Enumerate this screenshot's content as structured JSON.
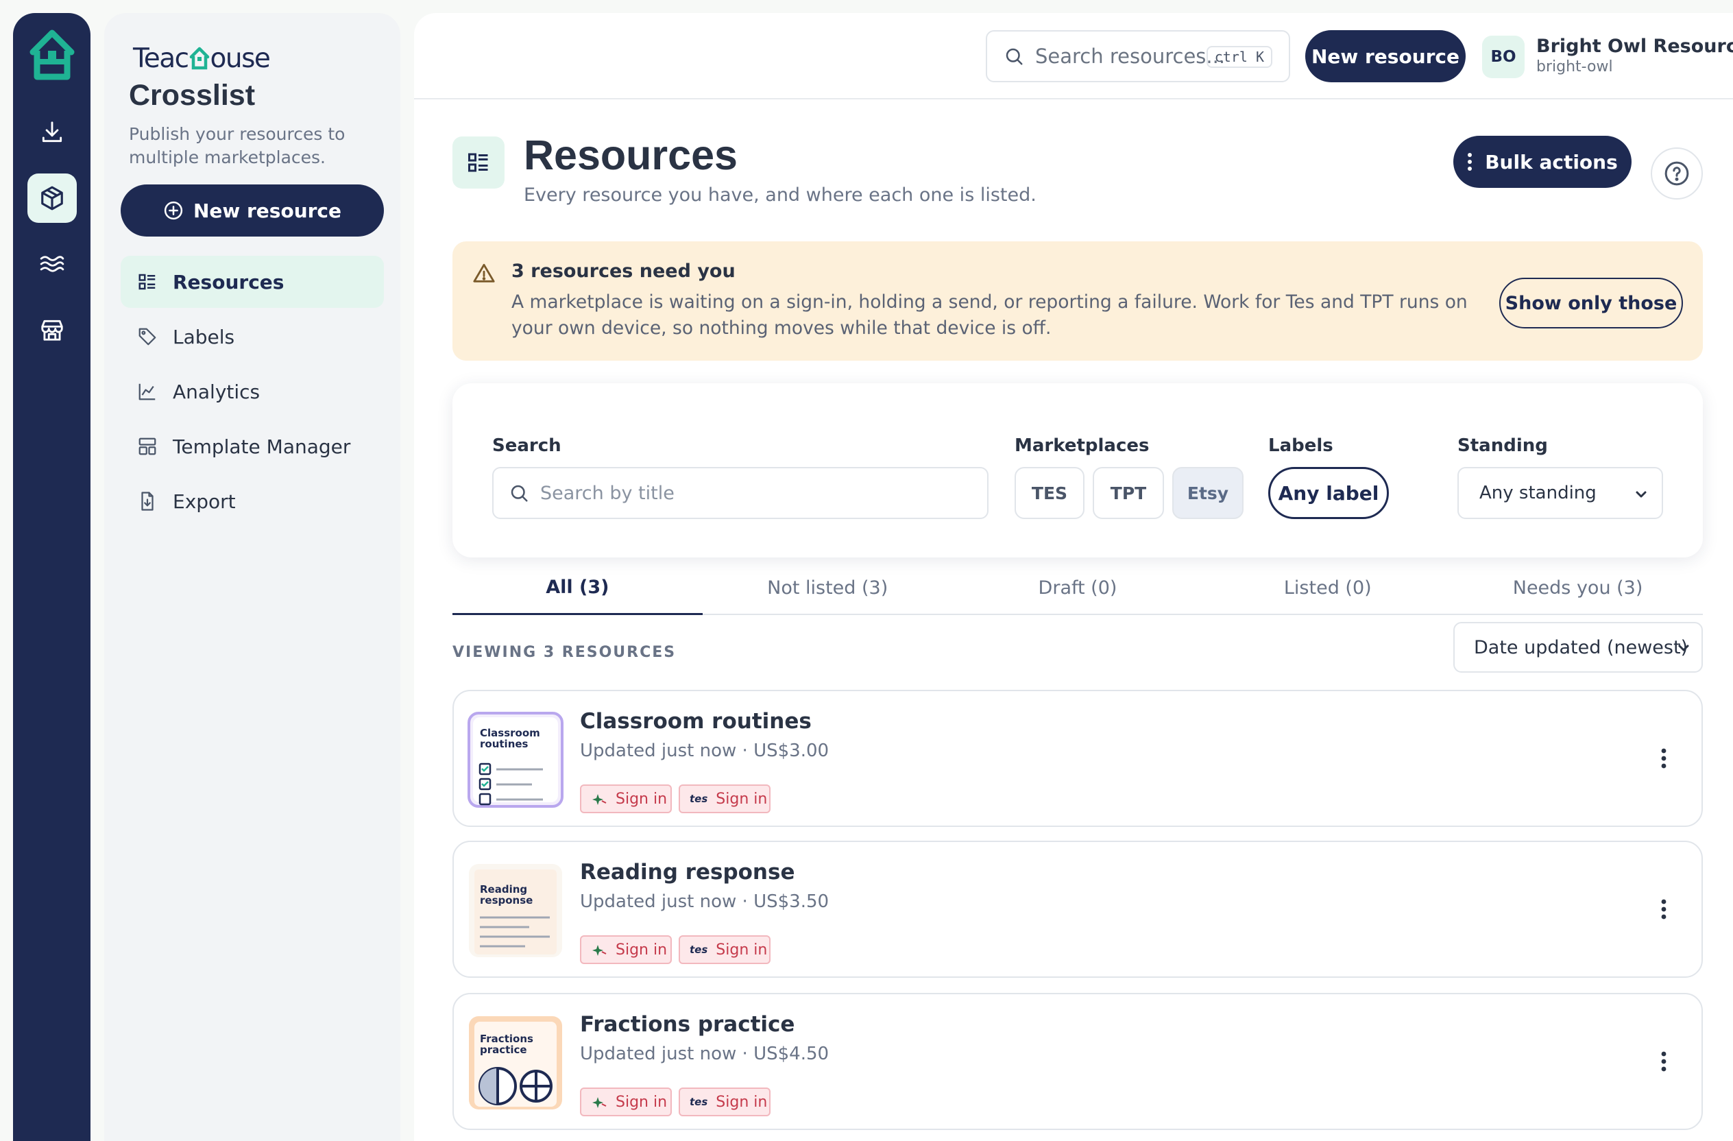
{
  "rail": {
    "items": [
      "download-icon",
      "package-icon",
      "waves-icon",
      "store-icon"
    ],
    "active_index": 1
  },
  "brand": {
    "logo_text_left": "Teac",
    "logo_text_right": "ouse",
    "app_title": "Crosslist",
    "app_subtitle": "Publish your resources to multiple marketplaces.",
    "new_resource_label": "New resource"
  },
  "nav": {
    "items": [
      {
        "label": "Resources",
        "icon": "list-icon",
        "active": true
      },
      {
        "label": "Labels",
        "icon": "tag-icon",
        "active": false
      },
      {
        "label": "Analytics",
        "icon": "chart-icon",
        "active": false
      },
      {
        "label": "Template Manager",
        "icon": "template-icon",
        "active": false
      },
      {
        "label": "Export",
        "icon": "export-icon",
        "active": false
      }
    ]
  },
  "topbar": {
    "search_placeholder": "Search resources...",
    "shortcut": "ctrl K",
    "new_resource_label": "New resource",
    "avatar_initials": "BO",
    "org_name": "Bright Owl Resources",
    "org_handle": "bright-owl"
  },
  "page": {
    "title": "Resources",
    "subtitle": "Every resource you have, and where each one is listed.",
    "bulk_actions_label": "Bulk actions"
  },
  "alert": {
    "title": "3 resources need you",
    "body": "A marketplace is waiting on a sign-in, holding a send, or reporting a failure. Work for Tes and TPT runs on your own device, so nothing moves while that device is off.",
    "action_label": "Show only those"
  },
  "filters": {
    "search_label": "Search",
    "search_placeholder": "Search by title",
    "marketplaces_label": "Marketplaces",
    "marketplaces": [
      {
        "label": "TES",
        "selected": false
      },
      {
        "label": "TPT",
        "selected": false
      },
      {
        "label": "Etsy",
        "selected": true
      }
    ],
    "labels_label": "Labels",
    "labels_value": "Any label",
    "standing_label": "Standing",
    "standing_value": "Any standing"
  },
  "tabs": [
    {
      "label": "All (3)",
      "active": true
    },
    {
      "label": "Not listed (3)",
      "active": false
    },
    {
      "label": "Draft (0)",
      "active": false
    },
    {
      "label": "Listed (0)",
      "active": false
    },
    {
      "label": "Needs you (3)",
      "active": false
    }
  ],
  "list": {
    "viewing_label": "VIEWING 3 RESOURCES",
    "sort_value": "Date updated (newest)"
  },
  "resources": [
    {
      "title": "Classroom routines",
      "meta": "Updated just now · US$3.00",
      "thumb_text": "Classroom routines",
      "chips": [
        {
          "marketplace": "tpt",
          "label": "Sign in"
        },
        {
          "marketplace": "tes",
          "mark": "tes",
          "label": "Sign in"
        }
      ]
    },
    {
      "title": "Reading response",
      "meta": "Updated just now · US$3.50",
      "thumb_text": "Reading response",
      "chips": [
        {
          "marketplace": "tpt",
          "label": "Sign in"
        },
        {
          "marketplace": "tes",
          "mark": "tes",
          "label": "Sign in"
        }
      ]
    },
    {
      "title": "Fractions practice",
      "meta": "Updated just now · US$4.50",
      "thumb_text": "Fractions practice",
      "chips": [
        {
          "marketplace": "tpt",
          "label": "Sign in"
        },
        {
          "marketplace": "tes",
          "mark": "tes",
          "label": "Sign in"
        }
      ]
    }
  ],
  "colors": {
    "navy": "#1e2a52",
    "mint": "#1fb394",
    "mint_bg": "#e3f5ee",
    "alert_bg": "#fdf0da",
    "chip_bg": "#fde8ea",
    "chip_text": "#c53a4b"
  }
}
